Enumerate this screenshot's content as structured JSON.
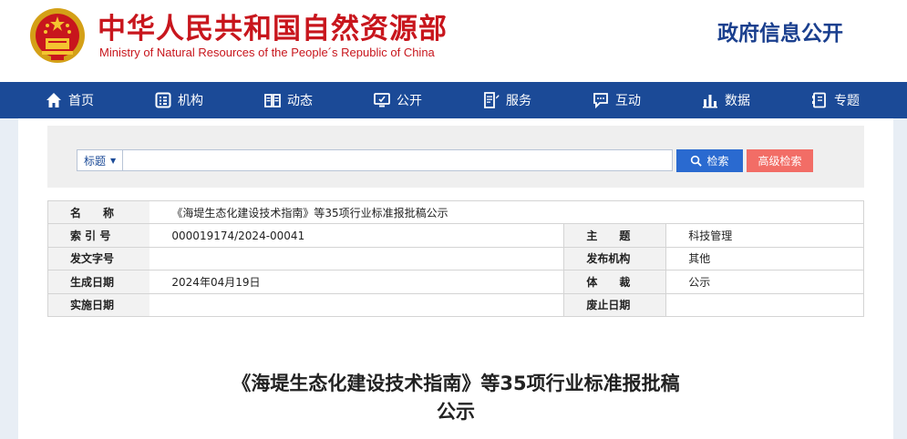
{
  "header": {
    "title": "中华人民共和国自然资源部",
    "subtitle": "Ministry of Natural Resources of the People´s Republic of China",
    "gov_info": "政府信息公开",
    "emblem_icon": "national-emblem-icon"
  },
  "nav": {
    "items": [
      {
        "label": "首页",
        "icon": "home-icon"
      },
      {
        "label": "机构",
        "icon": "org-icon"
      },
      {
        "label": "动态",
        "icon": "book-icon"
      },
      {
        "label": "公开",
        "icon": "monitor-icon"
      },
      {
        "label": "服务",
        "icon": "document-edit-icon"
      },
      {
        "label": "互动",
        "icon": "chat-icon"
      },
      {
        "label": "数据",
        "icon": "bar-chart-icon"
      },
      {
        "label": "专题",
        "icon": "folder-icon"
      }
    ]
  },
  "search": {
    "scope_label": "标题",
    "input_value": "",
    "search_button": "检索",
    "advanced_button": "高级检索"
  },
  "meta": {
    "name_label": "名　　称",
    "name_value": "《海堤生态化建设技术指南》等35项行业标准报批稿公示",
    "index_label": "索 引 号",
    "index_value": "000019174/2024-00041",
    "subject_label": "主　　题",
    "subject_value": "科技管理",
    "docno_label": "发文字号",
    "docno_value": "",
    "publisher_label": "发布机构",
    "publisher_value": "其他",
    "date_label": "生成日期",
    "date_value": "2024年04月19日",
    "genre_label": "体　　裁",
    "genre_value": "公示",
    "effective_label": "实施日期",
    "effective_value": "",
    "expire_label": "废止日期",
    "expire_value": ""
  },
  "article": {
    "title_line1": "《海堤生态化建设技术指南》等35项行业标准报批稿",
    "title_line2": "公示"
  },
  "colors": {
    "brand_red": "#c8161d",
    "nav_blue": "#1b4a97",
    "search_blue": "#2a6ad0",
    "advanced_red": "#f26d66"
  }
}
